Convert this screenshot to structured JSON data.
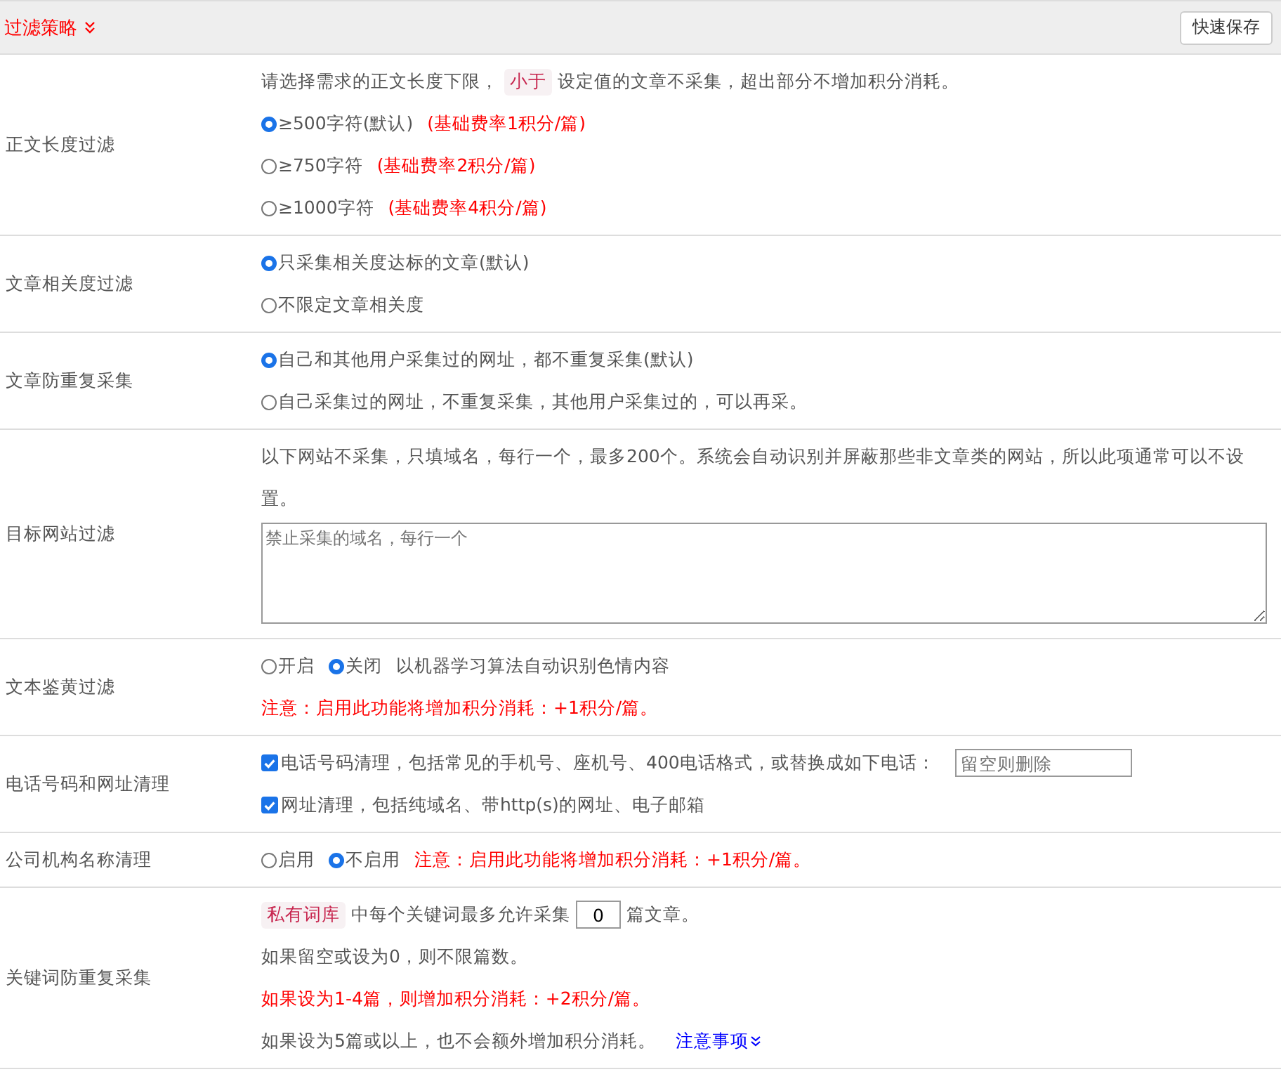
{
  "header": {
    "title": "过滤策略",
    "button": "快速保存"
  },
  "rows": [
    {
      "label": "正文长度过滤",
      "lines": [
        [
          {
            "kind": "text",
            "text": "请选择需求的正文长度下限，"
          },
          {
            "kind": "tag",
            "text": "小于"
          },
          {
            "kind": "text",
            "text": "设定值的文章不采集，超出部分不增加积分消耗。"
          }
        ],
        [
          {
            "kind": "radio",
            "label": "≥500字符(默认)",
            "selected": true
          },
          {
            "kind": "red",
            "text": "(基础费率1积分/篇)"
          }
        ],
        [
          {
            "kind": "radio",
            "label": "≥750字符",
            "selected": false
          },
          {
            "kind": "red",
            "text": "(基础费率2积分/篇)"
          }
        ],
        [
          {
            "kind": "radio",
            "label": "≥1000字符",
            "selected": false
          },
          {
            "kind": "red",
            "text": "(基础费率4积分/篇)"
          }
        ]
      ]
    },
    {
      "label": "文章相关度过滤",
      "lines": [
        [
          {
            "kind": "radio",
            "label": "只采集相关度达标的文章(默认)",
            "selected": true
          }
        ],
        [
          {
            "kind": "radio",
            "label": "不限定文章相关度",
            "selected": false
          }
        ]
      ]
    },
    {
      "label": "文章防重复采集",
      "lines": [
        [
          {
            "kind": "radio",
            "label": "自己和其他用户采集过的网址，都不重复采集(默认)",
            "selected": true
          }
        ],
        [
          {
            "kind": "radio",
            "label": "自己采集过的网址，不重复采集，其他用户采集过的，可以再采。",
            "selected": false
          }
        ]
      ]
    },
    {
      "label": "目标网站过滤",
      "lines": [
        [
          {
            "kind": "text",
            "text": "以下网站不采集，只填域名，每行一个，最多200个。系统会自动识别并屏蔽那些非文章类的网站，所以此项通常可以不设置。"
          }
        ],
        [
          {
            "kind": "textarea",
            "placeholder": "禁止采集的域名，每行一个"
          }
        ]
      ]
    },
    {
      "label": "文本鉴黄过滤",
      "lines": [
        [
          {
            "kind": "radio",
            "label": "开启",
            "selected": false
          },
          {
            "kind": "radio",
            "label": "关闭",
            "selected": true
          },
          {
            "kind": "text",
            "text": "以机器学习算法自动识别色情内容"
          }
        ],
        [
          {
            "kind": "red",
            "text": "注意：启用此功能将增加积分消耗：+1积分/篇。"
          }
        ]
      ]
    },
    {
      "label": "电话号码和网址清理",
      "lines": [
        [
          {
            "kind": "checkbox",
            "label": "电话号码清理，包括常见的手机号、座机号、400电话格式，或替换成如下电话：",
            "checked": true
          },
          {
            "kind": "input",
            "placeholder": "留空则删除"
          }
        ],
        [
          {
            "kind": "checkbox",
            "label": "网址清理，包括纯域名、带http(s)的网址、电子邮箱",
            "checked": true
          }
        ]
      ]
    },
    {
      "label": "公司机构名称清理",
      "lines": [
        [
          {
            "kind": "radio",
            "label": "启用",
            "selected": false
          },
          {
            "kind": "radio",
            "label": "不启用",
            "selected": true
          },
          {
            "kind": "red",
            "text": "注意：启用此功能将增加积分消耗：+1积分/篇。"
          }
        ]
      ]
    },
    {
      "label": "关键词防重复采集",
      "lines": [
        [
          {
            "kind": "tag",
            "text": "私有词库"
          },
          {
            "kind": "text",
            "text": "中每个关键词最多允许采集"
          },
          {
            "kind": "number",
            "value": "0"
          },
          {
            "kind": "text",
            "text": "篇文章。"
          }
        ],
        [
          {
            "kind": "text",
            "text": "如果留空或设为0，则不限篇数。"
          }
        ],
        [
          {
            "kind": "red",
            "text": "如果设为1-4篇，则增加积分消耗：+2积分/篇。"
          }
        ],
        [
          {
            "kind": "text",
            "text": "如果设为5篇或以上，也不会额外增加积分消耗。"
          },
          {
            "kind": "link",
            "text": "注意事项"
          }
        ]
      ]
    }
  ]
}
